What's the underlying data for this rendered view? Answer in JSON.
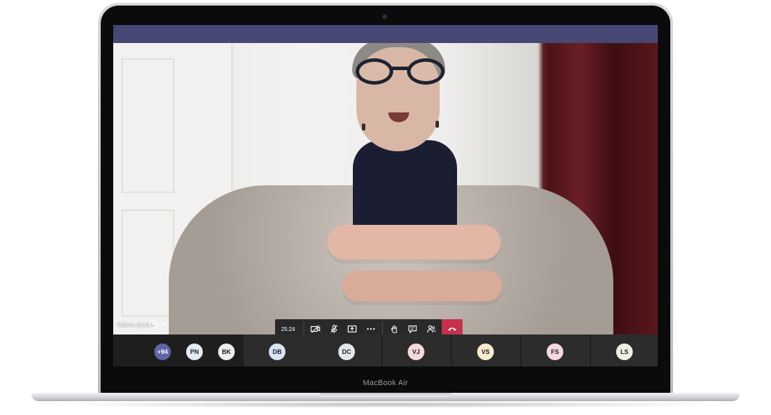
{
  "device": {
    "model_label": "MacBook Air"
  },
  "call": {
    "timer": "25:24",
    "controls": [
      {
        "name": "camera-off-icon",
        "label": "Turn camera on"
      },
      {
        "name": "mic-off-icon",
        "label": "Unmute"
      },
      {
        "name": "share-screen-icon",
        "label": "Share"
      },
      {
        "name": "more-actions-icon",
        "label": "More actions"
      },
      {
        "name": "raise-hand-icon",
        "label": "Raise hand"
      },
      {
        "name": "chat-icon",
        "label": "Show conversation"
      },
      {
        "name": "participants-icon",
        "label": "Show participants"
      },
      {
        "name": "hang-up-icon",
        "label": "Hang up"
      }
    ]
  },
  "main_video": {
    "participant_name": "Hélène (Invité)"
  },
  "participants": [
    {
      "initials": "+94",
      "color": "#6264a7"
    },
    {
      "initials": "PN",
      "color": "#e6ecf4"
    },
    {
      "initials": "BK",
      "color": "#eeeeee"
    },
    {
      "initials": "DB",
      "color": "#d8e4f2"
    },
    {
      "initials": "DC",
      "color": "#e3e8ee"
    },
    {
      "initials": "VJ",
      "color": "#f6d9dd"
    },
    {
      "initials": "VS",
      "color": "#f8eccf"
    },
    {
      "initials": "FS",
      "color": "#f6d8e2"
    },
    {
      "initials": "LS",
      "color": "#eef1e1"
    }
  ],
  "colors": {
    "teams_header": "#464775",
    "hangup": "#c4314b"
  }
}
